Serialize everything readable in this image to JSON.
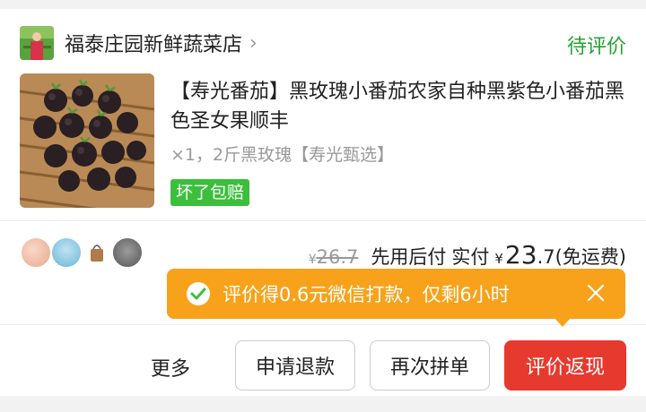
{
  "shop": {
    "name": "福泰庄园新鲜蔬菜店",
    "chevron": "›",
    "status": "待评价"
  },
  "product": {
    "title": "【寿光番茄】黑玫瑰小番茄农家自种黑紫色小番茄黑色圣女果顺丰",
    "spec": "×1，2斤黑玫瑰【寿光甄选】",
    "badge": "坏了包赔"
  },
  "price": {
    "yen_small": "¥",
    "original": "26.7",
    "pay_later": "先用后付",
    "paid_label": "实付",
    "yen": "¥",
    "paid_int": "23",
    "paid_dec": ".7",
    "shipping": "(免运费)"
  },
  "tooltip": {
    "text": "评价得0.6元微信打款，仅剩6小时"
  },
  "actions": {
    "more": "更多",
    "refund": "申请退款",
    "reorder": "再次拼单",
    "review": "评价返现"
  },
  "colors": {
    "status_green": "#24a32c",
    "badge_green": "#3bbf3c",
    "tooltip_orange": "#f7a21a",
    "review_red": "#e63a2e"
  }
}
